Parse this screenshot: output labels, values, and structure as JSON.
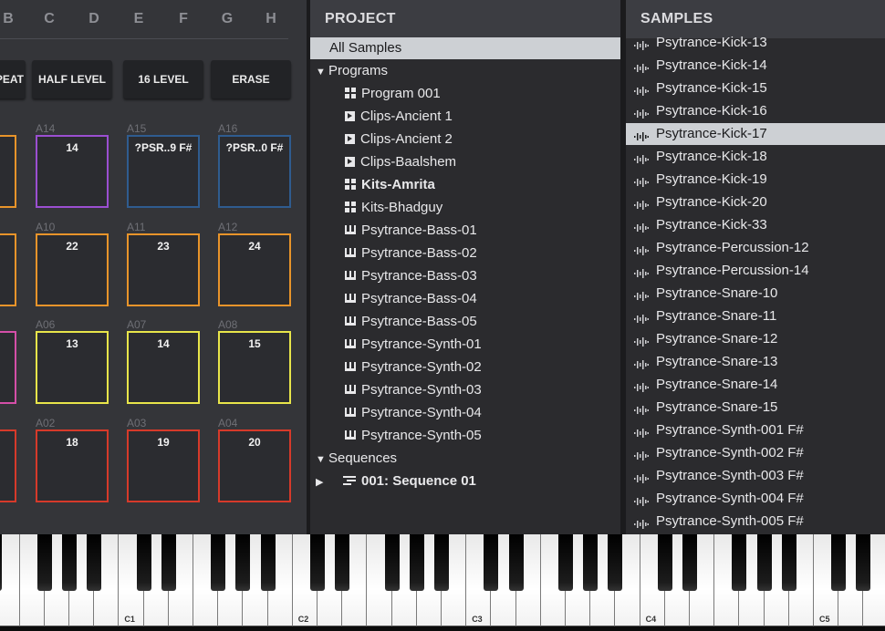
{
  "pad_panel": {
    "bank_letters": [
      "B",
      "C",
      "D",
      "E",
      "F",
      "G",
      "H"
    ],
    "buttons": {
      "repeat": "PEAT",
      "half_level": "HALF LEVEL",
      "level16": "16 LEVEL",
      "erase": "ERASE"
    },
    "pads": [
      {
        "label": "",
        "num": "",
        "color": "#e8942a"
      },
      {
        "label": "A14",
        "num": "14",
        "color": "#9b4fd1"
      },
      {
        "label": "A15",
        "num": "?PSR..9 F#",
        "color": "#2f5c8f"
      },
      {
        "label": "A16",
        "num": "?PSR..0 F#",
        "color": "#2f5c8f"
      },
      {
        "label": "",
        "num": "",
        "color": "#e8942a"
      },
      {
        "label": "A10",
        "num": "22",
        "color": "#e8942a"
      },
      {
        "label": "A11",
        "num": "23",
        "color": "#e8942a"
      },
      {
        "label": "A12",
        "num": "24",
        "color": "#e8942a"
      },
      {
        "label": "",
        "num": "",
        "color": "#d44fa8"
      },
      {
        "label": "A06",
        "num": "13",
        "color": "#e8e54a"
      },
      {
        "label": "A07",
        "num": "14",
        "color": "#e8e54a"
      },
      {
        "label": "A08",
        "num": "15",
        "color": "#e8e54a"
      },
      {
        "label": "",
        "num": "",
        "color": "#d63a2a"
      },
      {
        "label": "A02",
        "num": "18",
        "color": "#d63a2a"
      },
      {
        "label": "A03",
        "num": "19",
        "color": "#d63a2a"
      },
      {
        "label": "A04",
        "num": "20",
        "color": "#d63a2a"
      }
    ]
  },
  "project": {
    "header": "PROJECT",
    "all_samples": "All Samples",
    "programs_label": "Programs",
    "programs": [
      {
        "name": "Program 001",
        "icon": "grid-icon",
        "bold": false
      },
      {
        "name": "Clips-Ancient 1",
        "icon": "clip-icon",
        "bold": false
      },
      {
        "name": "Clips-Ancient 2",
        "icon": "clip-icon",
        "bold": false
      },
      {
        "name": "Clips-Baalshem",
        "icon": "clip-icon",
        "bold": false
      },
      {
        "name": "Kits-Amrita",
        "icon": "grid-icon",
        "bold": true
      },
      {
        "name": "Kits-Bhadguy",
        "icon": "grid-icon",
        "bold": false
      },
      {
        "name": "Psytrance-Bass-01",
        "icon": "keys-icon",
        "bold": false
      },
      {
        "name": "Psytrance-Bass-02",
        "icon": "keys-icon",
        "bold": false
      },
      {
        "name": "Psytrance-Bass-03",
        "icon": "keys-icon",
        "bold": false
      },
      {
        "name": "Psytrance-Bass-04",
        "icon": "keys-icon",
        "bold": false
      },
      {
        "name": "Psytrance-Bass-05",
        "icon": "keys-icon",
        "bold": false
      },
      {
        "name": "Psytrance-Synth-01",
        "icon": "keys-icon",
        "bold": false
      },
      {
        "name": "Psytrance-Synth-02",
        "icon": "keys-icon",
        "bold": false
      },
      {
        "name": "Psytrance-Synth-03",
        "icon": "keys-icon",
        "bold": false
      },
      {
        "name": "Psytrance-Synth-04",
        "icon": "keys-icon",
        "bold": false
      },
      {
        "name": "Psytrance-Synth-05",
        "icon": "keys-icon",
        "bold": false
      }
    ],
    "sequences_label": "Sequences",
    "sequences": [
      {
        "name": "001: Sequence 01",
        "icon": "sequence-icon"
      }
    ]
  },
  "samples": {
    "header": "SAMPLES",
    "selected_index": 4,
    "items": [
      "Psytrance-Kick-13",
      "Psytrance-Kick-14",
      "Psytrance-Kick-15",
      "Psytrance-Kick-16",
      "Psytrance-Kick-17",
      "Psytrance-Kick-18",
      "Psytrance-Kick-19",
      "Psytrance-Kick-20",
      "Psytrance-Kick-33",
      "Psytrance-Percussion-12",
      "Psytrance-Percussion-14",
      "Psytrance-Snare-10",
      "Psytrance-Snare-11",
      "Psytrance-Snare-12",
      "Psytrance-Snare-13",
      "Psytrance-Snare-14",
      "Psytrance-Snare-15",
      "Psytrance-Synth-001 F#",
      "Psytrance-Synth-002 F#",
      "Psytrance-Synth-003 F#",
      "Psytrance-Synth-004 F#",
      "Psytrance-Synth-005 F#"
    ]
  },
  "keyboard": {
    "octave_labels": [
      "C1",
      "C2",
      "C3",
      "C4",
      "C5"
    ]
  }
}
